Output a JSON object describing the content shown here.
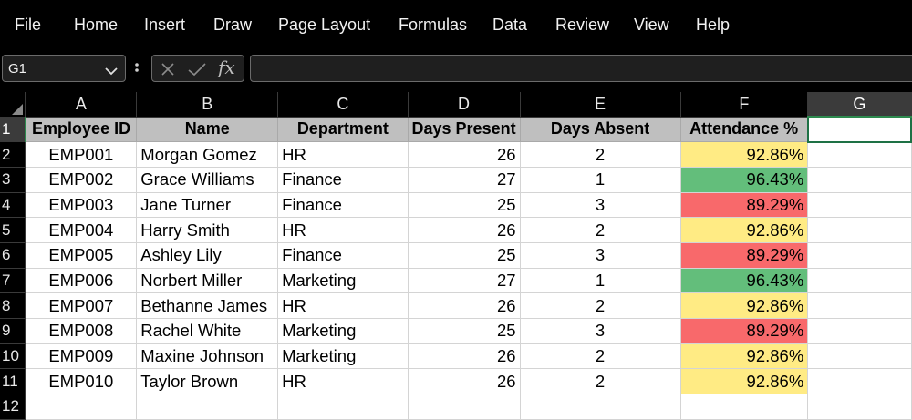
{
  "menu": [
    "File",
    "Home",
    "Insert",
    "Draw",
    "Page Layout",
    "Formulas",
    "Data",
    "Review",
    "View",
    "Help"
  ],
  "namebox": {
    "value": "G1"
  },
  "formula": {
    "fx_label": "fx",
    "value": ""
  },
  "columns": [
    "A",
    "B",
    "C",
    "D",
    "E",
    "F",
    "G"
  ],
  "selected_column": "G",
  "selected_row": "1",
  "header": {
    "row": "1",
    "employee_id": "Employee ID",
    "name": "Name",
    "department": "Department",
    "days_present": "Days Present",
    "days_absent": "Days Absent",
    "attendance": "Attendance %"
  },
  "rows": [
    {
      "row": "2",
      "id": "EMP001",
      "name": "Morgan Gomez",
      "dept": "HR",
      "present": "26",
      "absent": "2",
      "att": "92.86%",
      "color": "#ffeb84"
    },
    {
      "row": "3",
      "id": "EMP002",
      "name": "Grace Williams",
      "dept": "Finance",
      "present": "27",
      "absent": "1",
      "att": "96.43%",
      "color": "#63be7b"
    },
    {
      "row": "4",
      "id": "EMP003",
      "name": "Jane Turner",
      "dept": "Finance",
      "present": "25",
      "absent": "3",
      "att": "89.29%",
      "color": "#f8696b"
    },
    {
      "row": "5",
      "id": "EMP004",
      "name": "Harry Smith",
      "dept": "HR",
      "present": "26",
      "absent": "2",
      "att": "92.86%",
      "color": "#ffeb84"
    },
    {
      "row": "6",
      "id": "EMP005",
      "name": "Ashley Lily",
      "dept": "Finance",
      "present": "25",
      "absent": "3",
      "att": "89.29%",
      "color": "#f8696b"
    },
    {
      "row": "7",
      "id": "EMP006",
      "name": "Norbert Miller",
      "dept": "Marketing",
      "present": "27",
      "absent": "1",
      "att": "96.43%",
      "color": "#63be7b"
    },
    {
      "row": "8",
      "id": "EMP007",
      "name": "Bethanne James",
      "dept": "HR",
      "present": "26",
      "absent": "2",
      "att": "92.86%",
      "color": "#ffeb84"
    },
    {
      "row": "9",
      "id": "EMP008",
      "name": "Rachel White",
      "dept": "Marketing",
      "present": "25",
      "absent": "3",
      "att": "89.29%",
      "color": "#f8696b"
    },
    {
      "row": "10",
      "id": "EMP009",
      "name": "Maxine Johnson",
      "dept": "Marketing",
      "present": "26",
      "absent": "2",
      "att": "92.86%",
      "color": "#ffeb84"
    },
    {
      "row": "11",
      "id": "EMP010",
      "name": "Taylor Brown",
      "dept": "HR",
      "present": "26",
      "absent": "2",
      "att": "92.86%",
      "color": "#ffeb84"
    }
  ],
  "empty_row": "12"
}
